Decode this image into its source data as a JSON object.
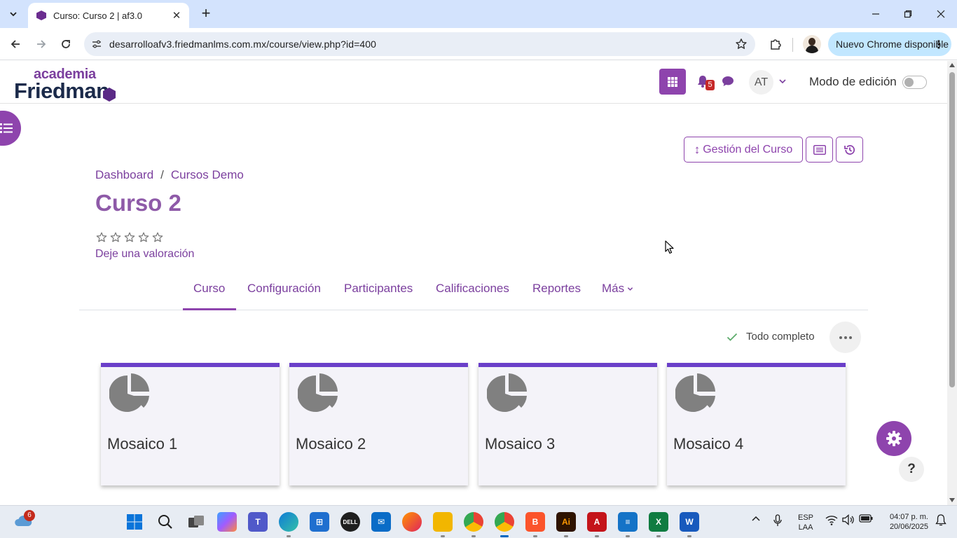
{
  "browser": {
    "tab_title": "Curso: Curso 2 | af3.0",
    "url": "desarrolloafv3.friedmanlms.com.mx/course/view.php?id=400",
    "update_label": "Nuevo Chrome disponible"
  },
  "header": {
    "logo_top": "academia",
    "logo_bottom": "Friedman",
    "notification_count": "5",
    "user_initials": "AT",
    "edit_mode_label": "Modo de edición",
    "edit_mode_on": false
  },
  "actions": {
    "course_management": "Gestión del Curso",
    "course_management_arrow": "↕"
  },
  "breadcrumb": {
    "items": [
      "Dashboard",
      "Cursos Demo"
    ],
    "separator": "/"
  },
  "course": {
    "title": "Curso 2",
    "rating_stars": 5,
    "rate_link": "Deje una valoración"
  },
  "tabs": [
    {
      "label": "Curso",
      "active": true
    },
    {
      "label": "Configuración",
      "active": false
    },
    {
      "label": "Participantes",
      "active": false
    },
    {
      "label": "Calificaciones",
      "active": false
    },
    {
      "label": "Reportes",
      "active": false
    },
    {
      "label": "Más",
      "active": false
    }
  ],
  "completion": {
    "label": "Todo completo"
  },
  "tiles": [
    {
      "name": "Mosaico 1",
      "icon": "pie-chart-icon"
    },
    {
      "name": "Mosaico 2",
      "icon": "pie-chart-icon"
    },
    {
      "name": "Mosaico 3",
      "icon": "pie-chart-icon"
    },
    {
      "name": "Mosaico 4",
      "icon": "pie-chart-icon"
    }
  ],
  "fab": {
    "help_label": "?"
  },
  "taskbar": {
    "weather_badge": "6",
    "language": "ESP",
    "keyboard": "LAA",
    "time": "04:07 p. m.",
    "date": "20/06/2025"
  },
  "colors": {
    "brand": "#8e44ad",
    "brand_text": "#7b3f9e",
    "tile_accent": "#6a3fc9",
    "chrome_tabbar": "#d3e3fd"
  }
}
